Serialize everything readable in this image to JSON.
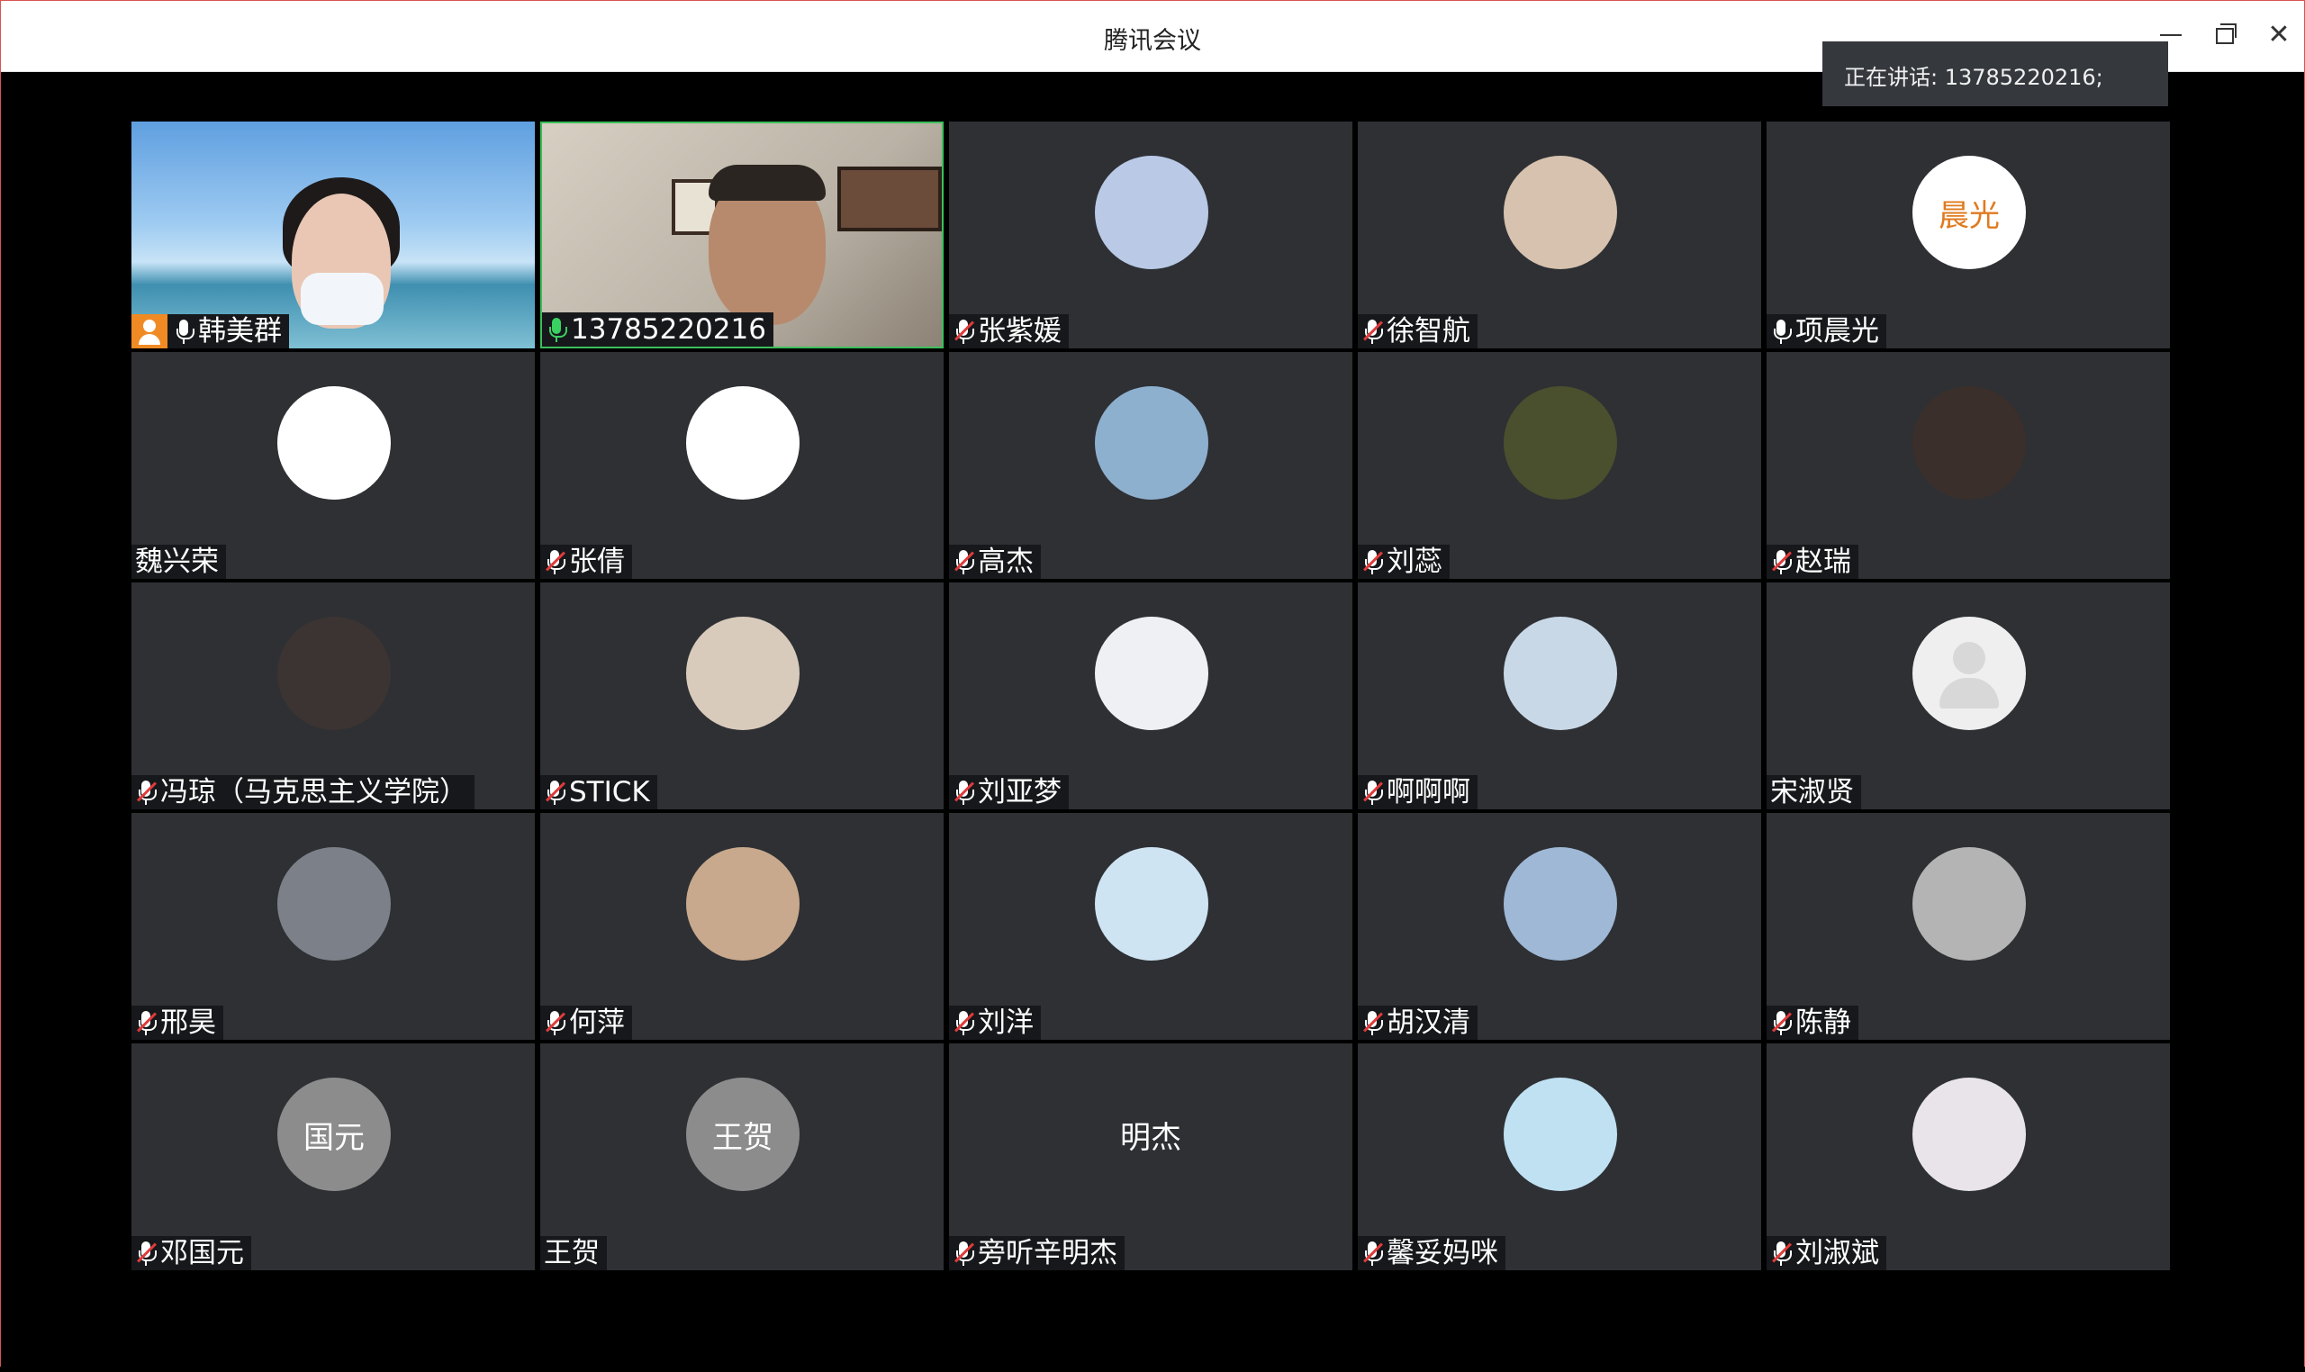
{
  "window": {
    "title": "腾讯会议",
    "controls": [
      "minimize-icon",
      "restore-icon",
      "close-icon"
    ]
  },
  "speaking_banner": "正在讲话: 13785220216;",
  "participants": [
    {
      "name": "韩美群",
      "mic": "on",
      "host": true,
      "kind": "video"
    },
    {
      "name": "13785220216",
      "mic": "active",
      "kind": "video"
    },
    {
      "name": "张紫媛",
      "mic": "muted",
      "avatar_color": "#b9c9e6"
    },
    {
      "name": "徐智航",
      "mic": "muted",
      "avatar_color": "#d6c2ae"
    },
    {
      "name": "项晨光",
      "mic": "on",
      "avatar_color": "#ffffff",
      "avatar_text": "晨光"
    },
    {
      "name": "魏兴荣",
      "mic": "none",
      "avatar_color": "#ffffff"
    },
    {
      "name": "张倩",
      "mic": "muted",
      "avatar_color": "#ffffff"
    },
    {
      "name": "高杰",
      "mic": "muted",
      "avatar_color": "#8eb0cf"
    },
    {
      "name": "刘蕊",
      "mic": "muted",
      "avatar_color": "#4a4f2e"
    },
    {
      "name": "赵瑞",
      "mic": "muted",
      "avatar_color": "#3a2f2a"
    },
    {
      "name": "冯琼（马克思主义学院）",
      "mic": "muted",
      "avatar_color": "#3b3433"
    },
    {
      "name": "STICK",
      "mic": "muted",
      "avatar_color": "#d9cbbb"
    },
    {
      "name": "刘亚梦",
      "mic": "muted",
      "avatar_color": "#eef0f4"
    },
    {
      "name": "啊啊啊",
      "mic": "muted",
      "avatar_color": "#c9d8e6"
    },
    {
      "name": "宋淑贤",
      "mic": "none",
      "avatar_color": "#efefef",
      "placeholder": true
    },
    {
      "name": "邢昊",
      "mic": "muted",
      "avatar_color": "#7c8088"
    },
    {
      "name": "何萍",
      "mic": "muted",
      "avatar_color": "#c8a98d"
    },
    {
      "name": "刘洋",
      "mic": "muted",
      "avatar_color": "#cfe4f3"
    },
    {
      "name": "胡汉清",
      "mic": "muted",
      "avatar_color": "#9fb8d6"
    },
    {
      "name": "陈静",
      "mic": "muted",
      "avatar_color": "#b4b4b4"
    },
    {
      "name": "邓国元",
      "mic": "muted",
      "avatar_color": "#8c8c8c",
      "avatar_text": "国元"
    },
    {
      "name": "王贺",
      "mic": "none",
      "avatar_color": "#8c8c8c",
      "avatar_text": "王贺"
    },
    {
      "name": "旁听辛明杰",
      "mic": "muted",
      "avatar_text": "明杰",
      "text_only": true
    },
    {
      "name": "馨妥妈咪",
      "mic": "muted",
      "avatar_color": "#bfe1f2"
    },
    {
      "name": "刘淑斌",
      "mic": "muted",
      "avatar_color": "#e8e4ea"
    }
  ]
}
